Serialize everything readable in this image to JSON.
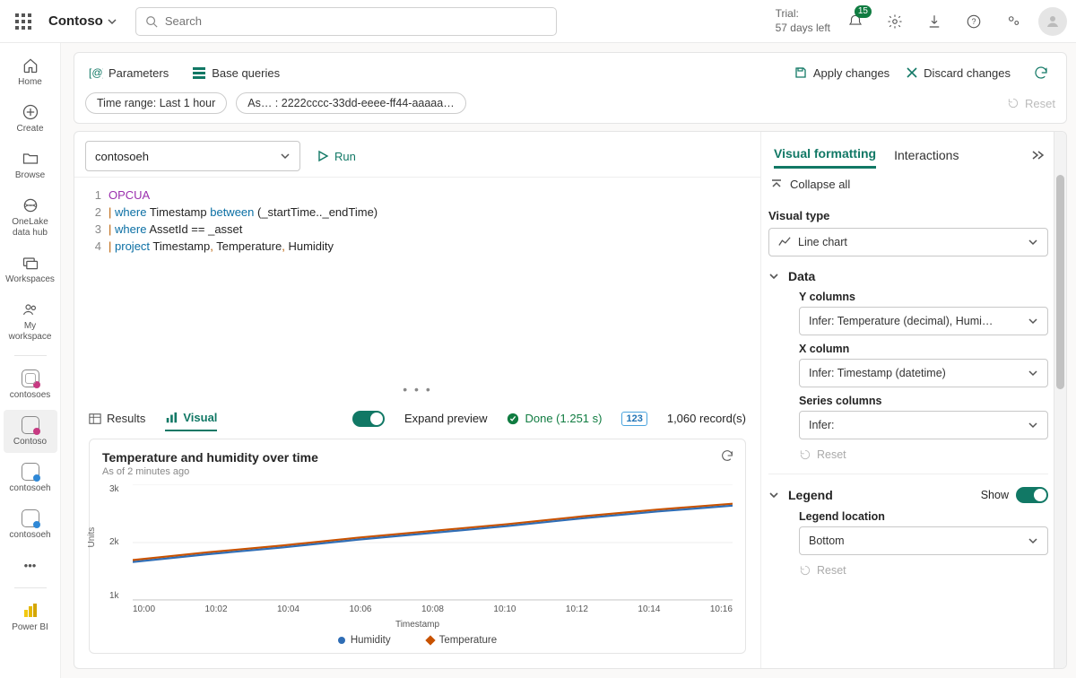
{
  "topbar": {
    "workspace": "Contoso",
    "search_placeholder": "Search",
    "trial_line1": "Trial:",
    "trial_line2": "57 days left",
    "notif_count": "15"
  },
  "leftnav": {
    "items": [
      {
        "label": "Home"
      },
      {
        "label": "Create"
      },
      {
        "label": "Browse"
      },
      {
        "label": "OneLake data hub"
      },
      {
        "label": "Workspaces"
      },
      {
        "label": "My workspace"
      },
      {
        "label": "contosoes"
      },
      {
        "label": "Contoso"
      },
      {
        "label": "contosoeh"
      },
      {
        "label": "contosoeh"
      },
      {
        "label": "Power BI"
      }
    ]
  },
  "toolbar": {
    "parameters": "Parameters",
    "base_queries": "Base queries",
    "apply": "Apply changes",
    "discard": "Discard changes"
  },
  "chips": {
    "time_range": "Time range: Last 1 hour",
    "asset": "As… : 2222cccc-33dd-eeee-ff44-aaaaa…",
    "reset": "Reset"
  },
  "editor": {
    "db": "contosoeh",
    "run": "Run",
    "lines": [
      "OPCUA",
      "| where Timestamp between (_startTime.._endTime)",
      "| where AssetId == _asset",
      "| project Timestamp, Temperature, Humidity"
    ]
  },
  "results": {
    "tab_results": "Results",
    "tab_visual": "Visual",
    "expand": "Expand preview",
    "done": "Done (1.251 s)",
    "records": "1,060 record(s)"
  },
  "chart_data": {
    "type": "line",
    "title": "Temperature and humidity over time",
    "subtitle": "As of 2 minutes ago",
    "xlabel": "Timestamp",
    "ylabel": "Units",
    "yticks": [
      "1k",
      "2k",
      "3k"
    ],
    "xticks": [
      "10:00",
      "10:02",
      "10:04",
      "10:06",
      "10:08",
      "10:10",
      "10:12",
      "10:14",
      "10:16"
    ],
    "ylim": [
      1000,
      3000
    ],
    "series": [
      {
        "name": "Humidity",
        "color": "#2f6db5",
        "marker": "circle",
        "values": [
          1700,
          1820,
          1920,
          2040,
          2150,
          2260,
          2380,
          2490,
          2600
        ]
      },
      {
        "name": "Temperature",
        "color": "#c85200",
        "marker": "diamond",
        "values": [
          1750,
          1870,
          1970,
          2090,
          2200,
          2310,
          2430,
          2540,
          2650
        ]
      }
    ],
    "legend_position": "Bottom"
  },
  "pane": {
    "tab_visual": "Visual formatting",
    "tab_interactions": "Interactions",
    "collapse": "Collapse all",
    "visual_type_label": "Visual type",
    "visual_type_value": "Line chart",
    "data_section": "Data",
    "ycols_label": "Y columns",
    "ycols_value": "Infer: Temperature (decimal), Humi…",
    "xcol_label": "X column",
    "xcol_value": "Infer: Timestamp (datetime)",
    "series_label": "Series columns",
    "series_value": "Infer:",
    "reset": "Reset",
    "legend_section": "Legend",
    "show": "Show",
    "legend_loc_label": "Legend location",
    "legend_loc_value": "Bottom"
  }
}
